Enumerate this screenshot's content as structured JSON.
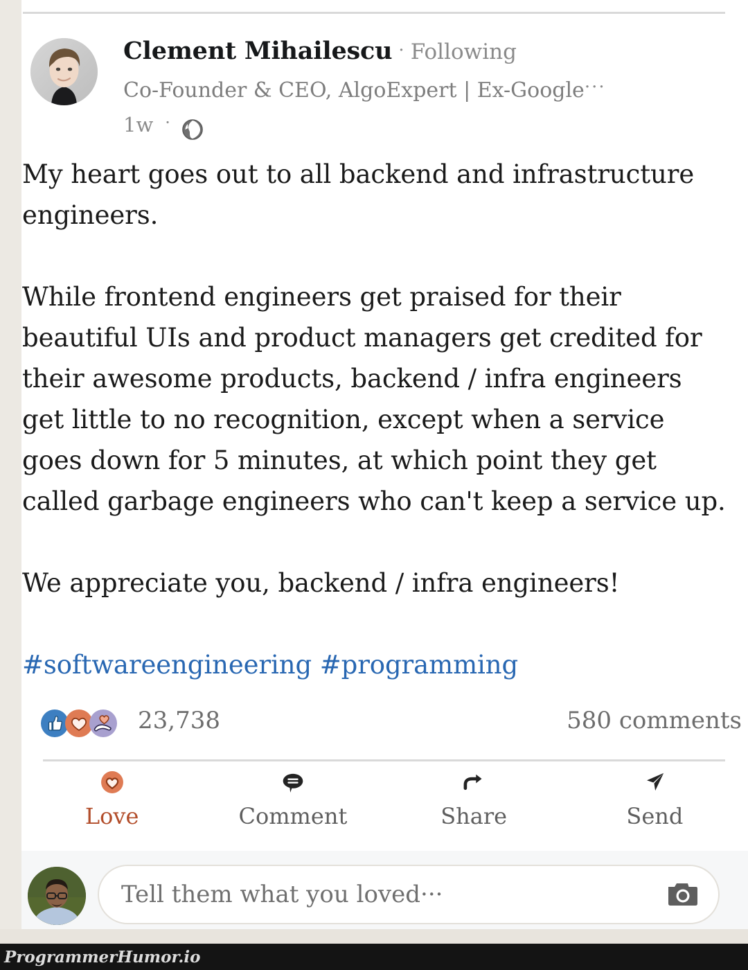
{
  "post": {
    "author_name": "Clement Mihailescu",
    "separator": "·",
    "following_label": "Following",
    "headline": "Co-Founder & CEO, AlgoExpert | Ex-Google",
    "headline_overflow": "···",
    "age": "1w",
    "meta_dot": "·",
    "visibility_icon": "globe-icon",
    "body_paragraphs": [
      "My heart goes out to all backend and infrastructure engineers.",
      "While frontend engineers get praised for their beautiful UIs and product managers get credited for their awesome products, backend / infra engineers get little to no recognition, except when a service goes down for 5 minutes, at which point they get called garbage engineers who can't keep a service up.",
      "We appreciate you, backend / infra engineers!"
    ],
    "hashtags": "#softwareengineering #programming"
  },
  "social": {
    "reaction_icons": [
      "like-thumbs-up-icon",
      "love-heart-icon",
      "care-hands-heart-icon"
    ],
    "reaction_count": "23,738",
    "comments_count": "580 comments"
  },
  "actions": [
    {
      "label": "Love",
      "icon": "love-heart-icon",
      "active": true
    },
    {
      "label": "Comment",
      "icon": "comment-bubble-icon",
      "active": false
    },
    {
      "label": "Share",
      "icon": "share-arrow-icon",
      "active": false
    },
    {
      "label": "Send",
      "icon": "send-paper-plane-icon",
      "active": false
    }
  ],
  "composer": {
    "placeholder": "Tell them what you loved···",
    "value": "",
    "camera_icon": "camera-icon",
    "avatar": "user-avatar"
  },
  "watermark": {
    "text": "ProgrammerHumor.io"
  },
  "colors": {
    "link_blue": "#2867b2",
    "love_orange": "#b24d2a",
    "like_blue": "#3d7fc1",
    "care_purple": "#a8a0cf",
    "text_dark": "#1a1a1a",
    "text_muted": "#7d7d7d",
    "divider": "#d9d9d9",
    "composer_bg": "#f6f7f8",
    "watermark_bg": "#141414"
  }
}
